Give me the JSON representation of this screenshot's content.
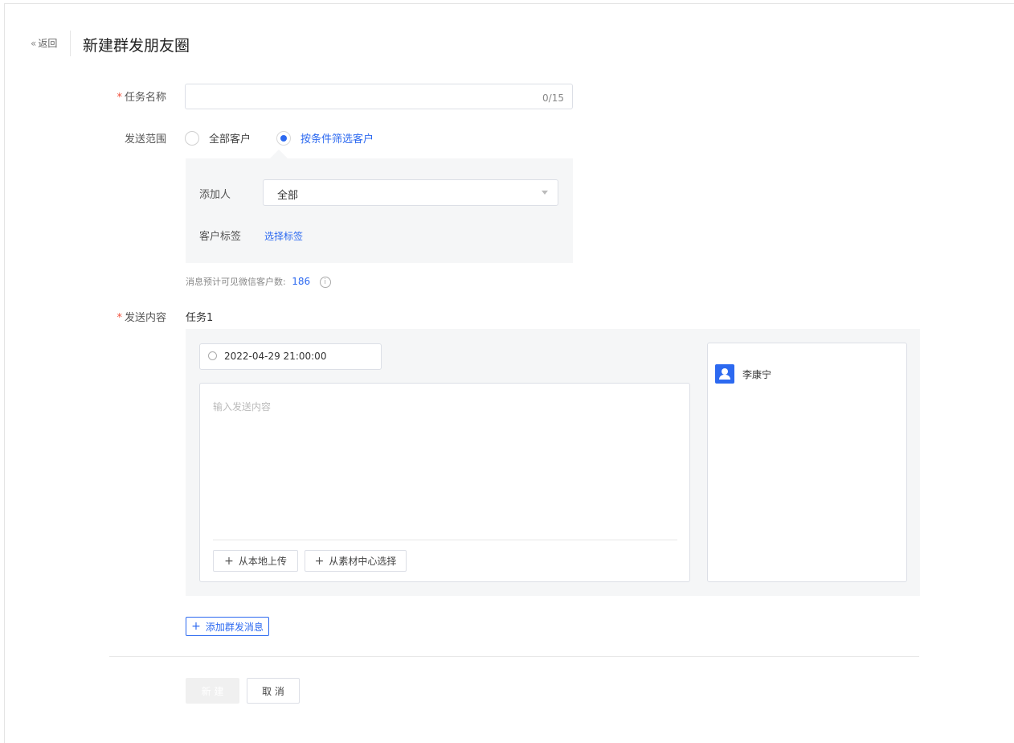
{
  "header": {
    "back_label": "返回",
    "title": "新建群发朋友圈"
  },
  "task_name": {
    "label": "任务名称",
    "counter": "0/15",
    "value": ""
  },
  "send_scope": {
    "label": "发送范围",
    "options": [
      {
        "label": "全部客户",
        "selected": false
      },
      {
        "label": "按条件筛选客户",
        "selected": true
      }
    ],
    "adder": {
      "label": "添加人",
      "value": "全部"
    },
    "tags": {
      "label": "客户标签",
      "link": "选择标签"
    },
    "estimate": {
      "text": "消息预计可见微信客户数:",
      "count": "186"
    }
  },
  "content": {
    "label": "发送内容",
    "task_title": "任务1",
    "datetime": "2022-04-29 21:00:00",
    "placeholder": "输入发送内容",
    "upload_local": "从本地上传",
    "upload_material": "从素材中心选择",
    "sender_name": "李康宁"
  },
  "add_message": "添加群发消息",
  "footer": {
    "create": "新 建",
    "cancel": "取 消"
  },
  "colors": {
    "accent": "#2c69f0",
    "required": "#f04e3a"
  }
}
